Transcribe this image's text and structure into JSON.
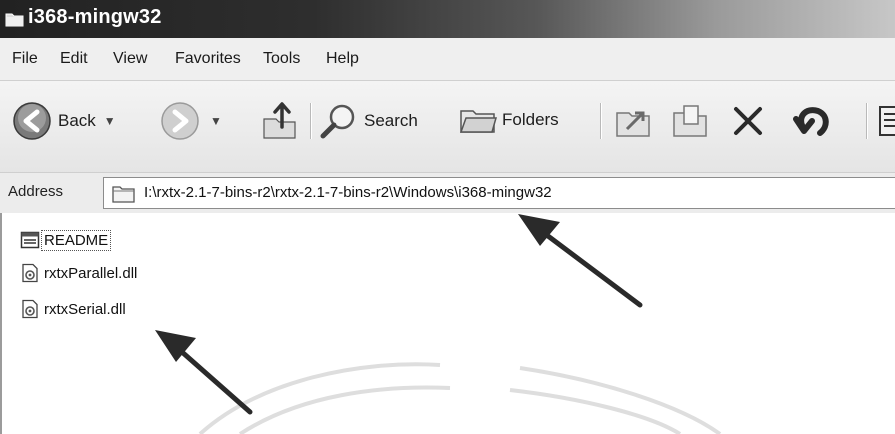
{
  "window": {
    "title": "i368-mingw32"
  },
  "menu": [
    "File",
    "Edit",
    "View",
    "Favorites",
    "Tools",
    "Help"
  ],
  "toolbar": {
    "back_label": "Back",
    "search_label": "Search",
    "folders_label": "Folders"
  },
  "address": {
    "label": "Address",
    "path": "I:\\rxtx-2.1-7-bins-r2\\rxtx-2.1-7-bins-r2\\Windows\\i368-mingw32"
  },
  "files": [
    {
      "name": "README",
      "icon": "text-file-icon",
      "selected": true
    },
    {
      "name": "rxtxParallel.dll",
      "icon": "dll-file-icon",
      "selected": false
    },
    {
      "name": "rxtxSerial.dll",
      "icon": "dll-file-icon",
      "selected": false
    }
  ]
}
